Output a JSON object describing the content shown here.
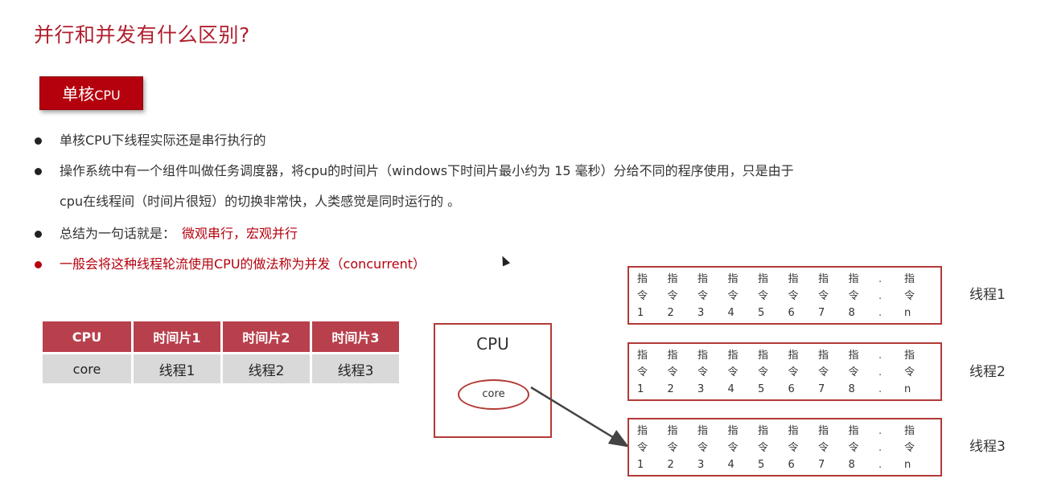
{
  "title": "并行和并发有什么区别?",
  "badge": {
    "cn": "单核",
    "en": "CPU"
  },
  "bullets": [
    {
      "text": "单核CPU下线程实际还是串行执行的"
    },
    {
      "line1": "操作系统中有一个组件叫做任务调度器，将cpu的时间片（windows下时间片最小约为 15 毫秒）分给不同的程序使用，只是由于",
      "line2": "cpu在线程间（时间片很短）的切换非常快，人类感觉是同时运行的 。"
    },
    {
      "text": "总结为一句话就是：",
      "highlight": "微观串行，宏观并行"
    },
    {
      "text": "一般会将这种线程轮流使用CPU的做法称为并发（concurrent）"
    }
  ],
  "table": {
    "headers": [
      "CPU",
      "时间片1",
      "时间片2",
      "时间片3"
    ],
    "row": [
      "core",
      "线程1",
      "线程2",
      "线程3"
    ]
  },
  "diagram": {
    "cpu_label": "CPU",
    "core_label": "core",
    "instruction_top": "指",
    "instruction_mid": "令",
    "instruction_nums": [
      "1",
      "2",
      "3",
      "4",
      "5",
      "6",
      "7",
      "8"
    ],
    "ellipsis": ".",
    "last_num": "n",
    "threads": [
      "线程1",
      "线程2",
      "线程3"
    ]
  },
  "colors": {
    "accent": "#b5000d",
    "header_bg": "#b8404c",
    "cell_bg": "#d9d9d9",
    "box_border": "#b23a36"
  }
}
